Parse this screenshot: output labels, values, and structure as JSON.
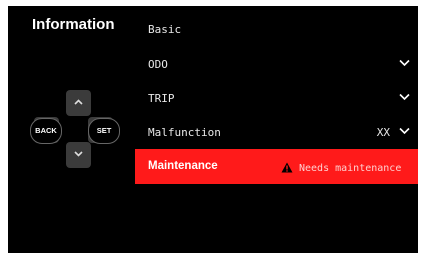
{
  "title": "Information",
  "menu": {
    "basic": "Basic",
    "odo": "ODO",
    "trip": "TRIP",
    "malfunction": "Malfunction",
    "malfunction_value": "XX",
    "maintenance": "Maintenance",
    "maintenance_status": "Needs maintenance"
  },
  "controls": {
    "back": "BACK",
    "set": "SET"
  },
  "icons": [
    "chevron-down-icon",
    "warning-icon",
    "arrow-up-icon",
    "arrow-down-icon"
  ],
  "colors": {
    "background": "#000000",
    "selected_row": "#ff1a1a",
    "button": "#3b3b3b"
  }
}
